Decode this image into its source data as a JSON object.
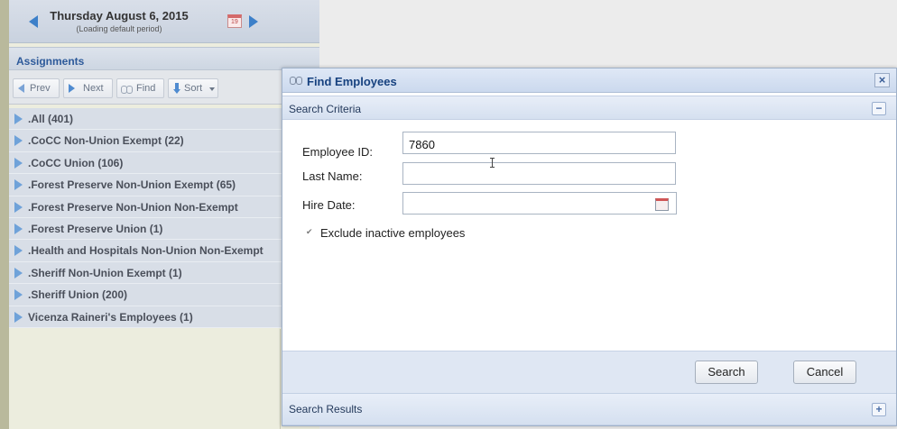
{
  "date_nav": {
    "date": "Thursday August 6, 2015",
    "subtext": "(Loading default period)",
    "calendar_icon": "calendar-icon",
    "calendar_day": "19"
  },
  "assignments": {
    "title": "Assignments",
    "toolbar": {
      "prev": "Prev",
      "next": "Next",
      "find": "Find",
      "sort": "Sort"
    },
    "items": [
      ".All (401)",
      ".CoCC Non-Union Exempt (22)",
      ".CoCC Union (106)",
      ".Forest Preserve Non-Union Exempt (65)",
      ".Forest Preserve Non-Union Non-Exempt",
      ".Forest Preserve Union (1)",
      ".Health and Hospitals Non-Union Non-Exempt",
      ".Sheriff Non-Union Exempt (1)",
      ".Sheriff Union (200)",
      "Vicenza Raineri's Employees (1)"
    ]
  },
  "dialog": {
    "title": "Find Employees",
    "close": "×",
    "criteria_section": {
      "title": "Search Criteria",
      "toggle": "−"
    },
    "fields": {
      "employee_id_label": "Employee ID:",
      "employee_id_value": "7860",
      "last_name_label": "Last Name:",
      "last_name_value": "",
      "hire_date_label": "Hire Date:",
      "hire_date_value": ""
    },
    "exclude_inactive": {
      "label": "Exclude inactive employees",
      "checked": true,
      "mark": "✔"
    },
    "buttons": {
      "search": "Search",
      "cancel": "Cancel"
    },
    "results_section": {
      "title": "Search Results",
      "toggle": "+"
    }
  }
}
